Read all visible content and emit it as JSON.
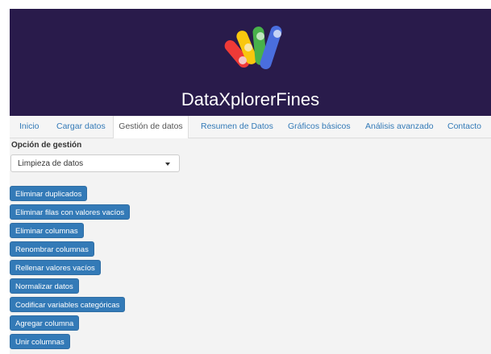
{
  "app": {
    "title": "DataXplorerFines"
  },
  "colors": {
    "header_bg": "#291b4b",
    "primary": "#337ab7"
  },
  "nav": {
    "tabs": [
      {
        "label": "Inicio",
        "active": false
      },
      {
        "label": "Cargar datos",
        "active": false
      },
      {
        "label": "Gestión de datos",
        "active": true
      },
      {
        "label": "Resumen de Datos",
        "active": false
      },
      {
        "label": "Gráficos básicos",
        "active": false
      },
      {
        "label": "Análisis avanzado",
        "active": false
      },
      {
        "label": "Contacto",
        "active": false
      }
    ]
  },
  "management": {
    "label": "Opción de gestión",
    "select": {
      "value": "Limpieza de datos",
      "icon": "chevron-down-icon"
    },
    "actions": [
      "Eliminar duplicados",
      "Eliminar filas con valores vacíos",
      "Eliminar columnas",
      "Renombrar columnas",
      "Rellenar valores vacíos",
      "Normalizar datos",
      "Codificar variables categóricas",
      "Agregar columna",
      "Unir columnas"
    ]
  }
}
